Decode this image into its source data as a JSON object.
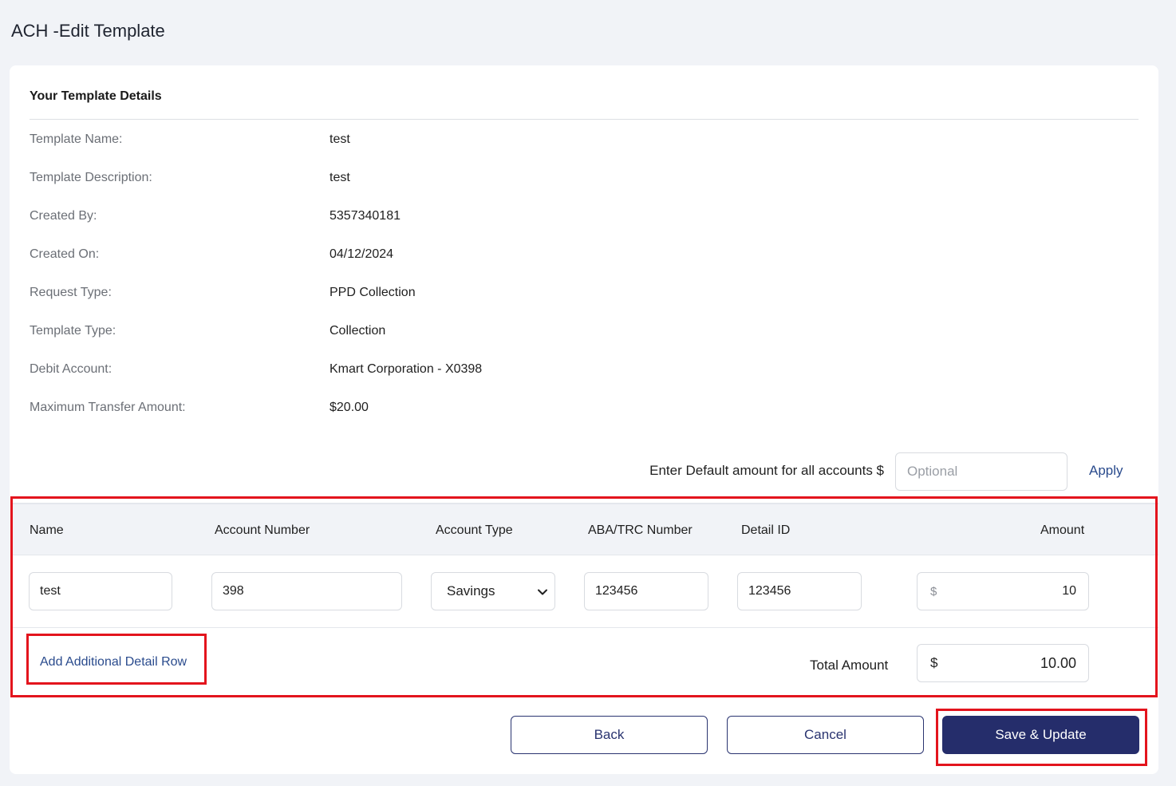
{
  "page": {
    "title": "ACH -Edit Template"
  },
  "details": {
    "heading": "Your Template Details",
    "rows": [
      {
        "label": "Template Name:",
        "value": "test"
      },
      {
        "label": "Template Description:",
        "value": "test"
      },
      {
        "label": "Created By:",
        "value": "5357340181"
      },
      {
        "label": "Created On:",
        "value": "04/12/2024"
      },
      {
        "label": "Request Type:",
        "value": "PPD Collection"
      },
      {
        "label": "Template Type:",
        "value": "Collection"
      },
      {
        "label": "Debit Account:",
        "value": "Kmart Corporation - X0398"
      },
      {
        "label": "Maximum Transfer Amount:",
        "value": "$20.00"
      }
    ]
  },
  "default_amount": {
    "label": "Enter Default amount for all accounts $",
    "placeholder": "Optional",
    "value": "",
    "apply_label": "Apply"
  },
  "table": {
    "headers": [
      "Name",
      "Account Number",
      "Account Type",
      "ABA/TRC Number",
      "Detail ID",
      "Amount"
    ],
    "rows": [
      {
        "name": "test",
        "account_number": "398",
        "account_type": "Savings",
        "aba_trc": "123456",
        "detail_id": "123456",
        "currency": "$",
        "amount": "10"
      }
    ]
  },
  "footer": {
    "add_row_label": "Add Additional Detail Row",
    "total_label": "Total Amount",
    "total_currency": "$",
    "total_value": "10.00"
  },
  "actions": {
    "back_label": "Back",
    "cancel_label": "Cancel",
    "save_label": "Save & Update"
  },
  "colors": {
    "highlight": "#e3141d",
    "primary": "#252d6b",
    "link": "#2a4b8d"
  },
  "icons": {
    "select_arrow": "chevron-down-icon"
  }
}
